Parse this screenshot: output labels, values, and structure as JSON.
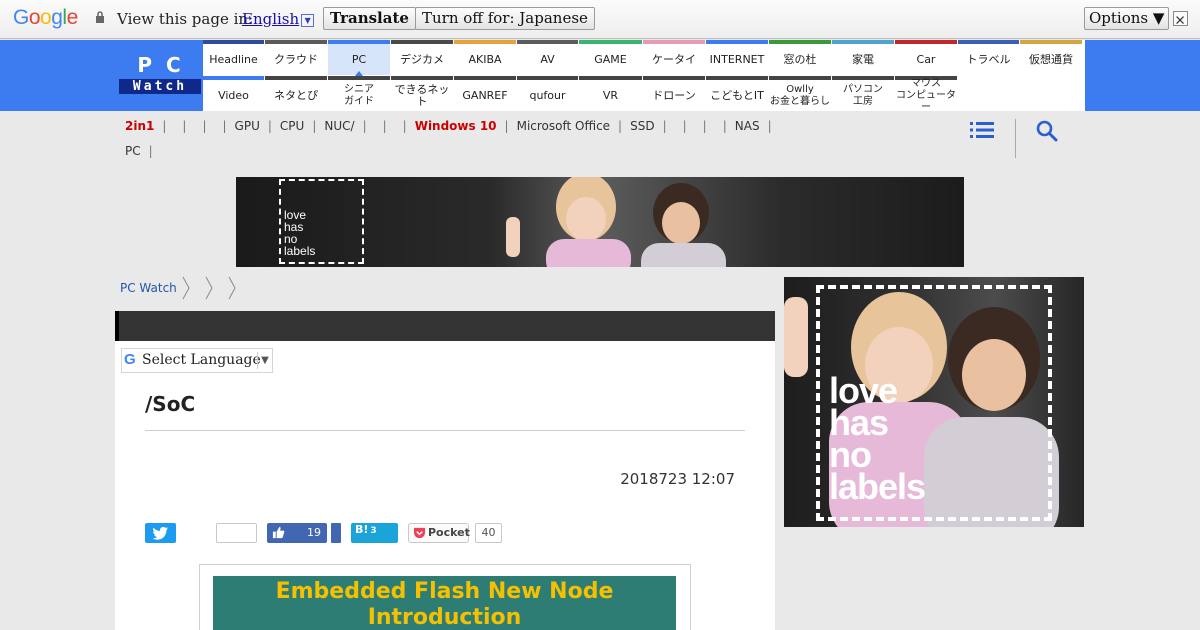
{
  "translate_bar": {
    "logo_letters": [
      "G",
      "o",
      "o",
      "g",
      "l",
      "e"
    ],
    "view_text": "View this page in:",
    "language": "English",
    "translate_label": "Translate",
    "turnoff_label": "Turn off for: Japanese",
    "options_label": "Options ▼"
  },
  "site": {
    "logo_pc": "PC",
    "logo_watch": "Watch"
  },
  "nav": {
    "top": [
      {
        "label": "Headline",
        "color": "#2e4c99"
      },
      {
        "label": "クラウド",
        "color": "#5b5b5b"
      },
      {
        "label": "PC",
        "color": "#3c7cf0",
        "active": true
      },
      {
        "label": "デジカメ",
        "color": "#4a4a4a"
      },
      {
        "label": "AKIBA",
        "color": "#e6a23c"
      },
      {
        "label": "AV",
        "color": "#5c5c5c"
      },
      {
        "label": "GAME",
        "color": "#3cb371"
      },
      {
        "label": "ケータイ",
        "color": "#e899b3"
      },
      {
        "label": "INTERNET",
        "color": "#3c7cf0"
      },
      {
        "label": "窓の杜",
        "color": "#3a9a3a"
      },
      {
        "label": "家電",
        "color": "#4fa3d1"
      },
      {
        "label": "Car",
        "color": "#c0282e"
      },
      {
        "label": "トラベル",
        "color": "#3b5fb5"
      },
      {
        "label": "仮想通貨",
        "color": "#d4a640"
      }
    ],
    "bottom": [
      {
        "label": "Video",
        "color": "#3c7cf0"
      },
      {
        "label": "ネタとぴ",
        "color": "#444"
      },
      {
        "label": "シニア\nガイド",
        "color": "#444"
      },
      {
        "label": "できるネット",
        "color": "#444"
      },
      {
        "label": "GANREF",
        "color": "#444"
      },
      {
        "label": "qufour",
        "color": "#444"
      },
      {
        "label": "VR",
        "color": "#444"
      },
      {
        "label": "ドローン",
        "color": "#444"
      },
      {
        "label": "こどもとIT",
        "color": "#444"
      },
      {
        "label": "Owlly\nお金と暮らし",
        "color": "#444"
      },
      {
        "label": "パソコン\n工房",
        "color": "#444"
      },
      {
        "label": "マウス\nコンピューター",
        "color": "#444"
      }
    ]
  },
  "subnav": {
    "row1": [
      "2in1",
      "",
      "",
      "",
      "GPU",
      "CPU",
      "NUC/",
      "",
      "",
      "Windows 10",
      "Microsoft Office",
      "SSD",
      "",
      "",
      "",
      "NAS"
    ],
    "row2": [
      "PC"
    ]
  },
  "ads": {
    "banner_text": [
      "love",
      "has",
      "no",
      "labels"
    ]
  },
  "breadcrumb": {
    "home": "PC Watch"
  },
  "article": {
    "select_language": "Select Language",
    "title": "/SoC",
    "date": "2018723 12:07",
    "fb_count": "19",
    "hatena_label": "B!",
    "hatena_count": "3",
    "pocket_label": "Pocket",
    "pocket_count": "40",
    "slide_title": "Embedded Flash New Node Introduction"
  }
}
